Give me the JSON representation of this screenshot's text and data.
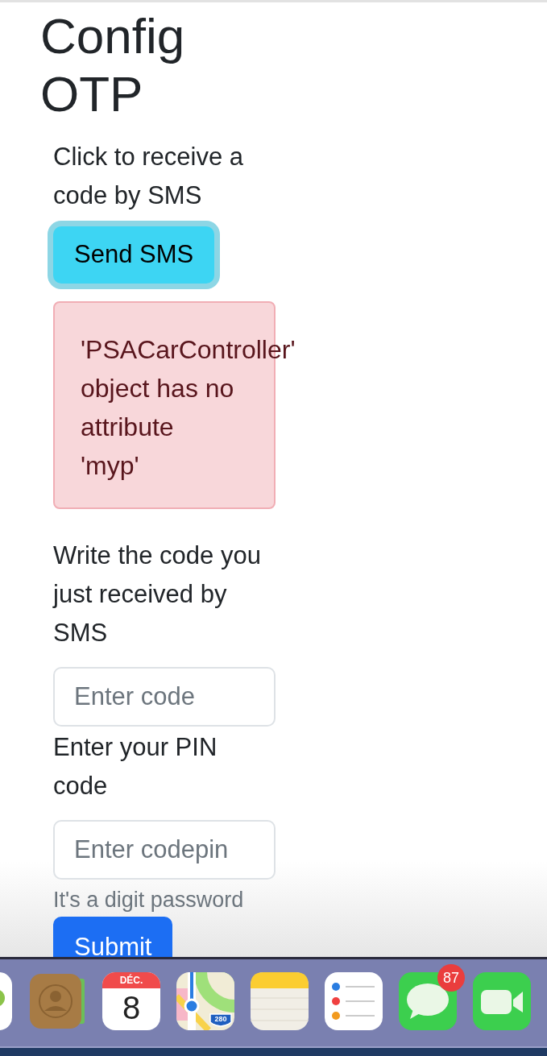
{
  "heading": "Config OTP",
  "send_section": {
    "label": "Click to receive a code by SMS",
    "button": {
      "label": "Send SMS",
      "focused": true
    }
  },
  "alert": {
    "message": "'PSACarController' object has no attribute 'myp'"
  },
  "code_field": {
    "label": "Write the code you just received by SMS",
    "placeholder": "Enter code"
  },
  "pin_field": {
    "label": "Enter your PIN code",
    "placeholder": "Enter codepin",
    "help": "It's a digit password"
  },
  "submit": {
    "label": "Submit"
  },
  "dock": {
    "items": [
      {
        "kind": "photos"
      },
      {
        "kind": "contacts"
      },
      {
        "kind": "calendar",
        "month": "DÉC.",
        "day": "8"
      },
      {
        "kind": "maps",
        "shield": "280"
      },
      {
        "kind": "notes"
      },
      {
        "kind": "reminders"
      },
      {
        "kind": "messages",
        "badge": "87"
      },
      {
        "kind": "facetime"
      }
    ]
  }
}
